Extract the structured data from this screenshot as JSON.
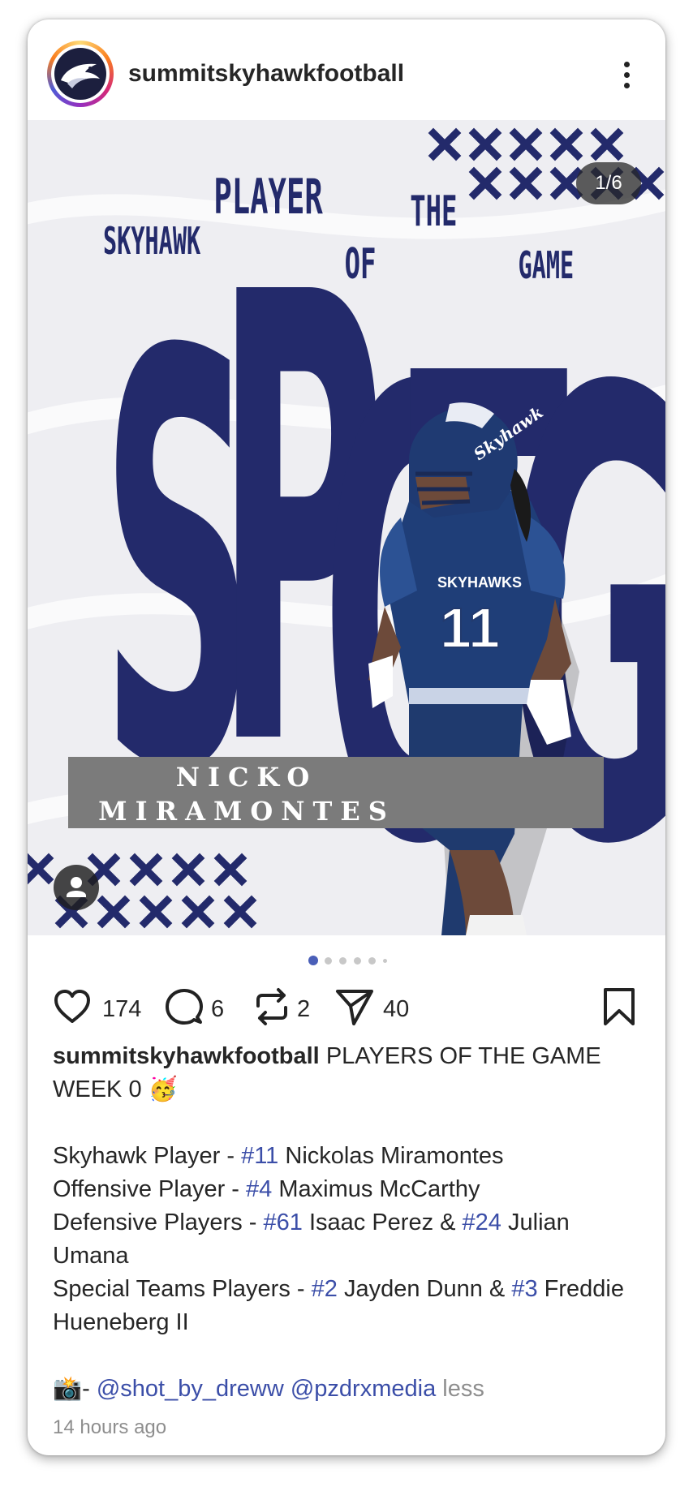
{
  "post": {
    "username": "summitskyhawkfootball",
    "counter": "1/6",
    "graphic": {
      "words": [
        "SKYHAWK",
        "PLAYER",
        "OF",
        "THE",
        "GAME"
      ],
      "big_letters": [
        "S",
        "P",
        "O",
        "T",
        "G"
      ],
      "player_first": "NICKO",
      "player_last": "MIRAMONTES",
      "jersey_text": "SKYHAWKS",
      "jersey_number": "11",
      "helmet_text": "Skyhawk"
    },
    "carousel": {
      "total": 6,
      "active": 1
    }
  },
  "actions": {
    "likes": "174",
    "comments": "6",
    "reposts": "2",
    "shares": "40"
  },
  "caption": {
    "username": "summitskyhawkfootball",
    "headline": "PLAYERS OF THE GAME WEEK 0",
    "emoji": "🥳",
    "line1_pre": "Skyhawk Player -",
    "line1_tag": "#11",
    "line1_post": "Nickolas Miramontes",
    "line2_pre": "Offensive Player -",
    "line2_tag": "#4",
    "line2_post": "Maximus McCarthy",
    "line3_pre": "Defensive Players -",
    "line3_tag1": "#61",
    "line3_mid": "Isaac Perez &",
    "line3_tag2": "#24",
    "line3_post": "Julian Umana",
    "line4_pre": "Special Teams Players -",
    "line4_tag1": "#2",
    "line4_mid": "Jayden Dunn &",
    "line4_tag2": "#3",
    "line4_post": "Freddie Hueneberg II",
    "credit_icon": "📸",
    "credit_dash": "-",
    "mention1": "@shot_by_dreww",
    "mention2": "@pzdrxmedia",
    "less": "less"
  },
  "timestamp": "14 hours ago",
  "colors": {
    "navy": "#232a6b",
    "link": "#3b4ea8",
    "name_bar": "#7b7b7b",
    "dot_active": "#4a5fb8"
  }
}
